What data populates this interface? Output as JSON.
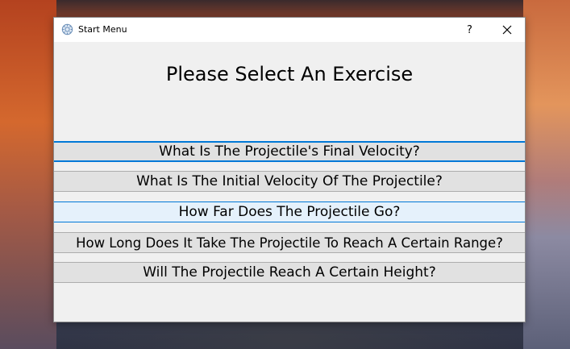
{
  "window": {
    "title": "Start Menu",
    "help_label": "?",
    "icons": {
      "app": "gear-icon",
      "close": "close-icon"
    }
  },
  "main": {
    "heading": "Please Select An Exercise",
    "exercises": [
      {
        "label": "What Is The Projectile's Final Velocity?",
        "state": "focused"
      },
      {
        "label": "What Is The Initial Velocity Of The Projectile?",
        "state": "normal"
      },
      {
        "label": "How Far Does The Projectile Go?",
        "state": "hovered"
      },
      {
        "label": "How Long Does It Take The Projectile To Reach A Certain Range?",
        "state": "normal"
      },
      {
        "label": "Will The Projectile Reach A Certain Height?",
        "state": "normal"
      }
    ]
  },
  "colors": {
    "accent": "#0078d7",
    "button_bg": "#e1e1e1",
    "hover_bg": "#e5f1fb",
    "window_bg": "#f0f0f0"
  }
}
